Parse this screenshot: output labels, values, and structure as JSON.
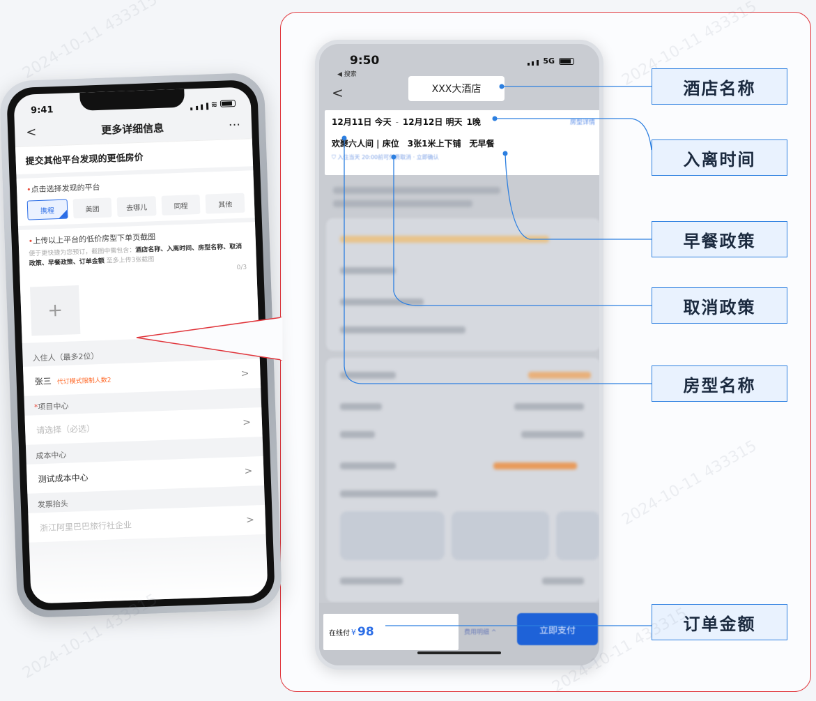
{
  "left_phone": {
    "status_time": "9:41",
    "nav_title": "更多详细信息",
    "nav_back": "<",
    "nav_more": "···",
    "section_title": "提交其他平台发现的更低房价",
    "platform_prompt": "点击选择发现的平台",
    "platforms": [
      "携程",
      "美团",
      "去哪儿",
      "同程",
      "其他"
    ],
    "upload_prompt": "上传以上平台的低价房型下单页截图",
    "upload_hint_prefix": "便于更快捷为您预订，截图中需包含：",
    "upload_hint_required": "酒店名称、入离时间、房型名称、取消政策、早餐政策、订单金额",
    "upload_hint_suffix": "至多上传3张截图",
    "upload_count": "0/3",
    "upload_plus": "+",
    "guest_label": "入住人（最多2位）",
    "guest_name": "张三",
    "guest_note": "代订模式限制人数2",
    "project_label": "项目中心",
    "project_placeholder": "请选择（必选）",
    "cost_label": "成本中心",
    "cost_value": "测试成本中心",
    "invoice_label": "发票抬头",
    "invoice_value": "浙江阿里巴巴旅行社企业",
    "arrow": ">"
  },
  "right_phone": {
    "status_time": "9:50",
    "status_sub": "◀ 搜索",
    "status_net": "5G",
    "back": "<",
    "hotel_name": "XXX大酒店",
    "check_in": "12月11日 今天",
    "dash": "-",
    "check_out": "12月12日 明天",
    "nights": "1晚",
    "room_detail_link": "房型详情",
    "room_name": "欢聚六人间 | 床位",
    "bed_type": "3张1米上下铺",
    "breakfast": "无早餐",
    "cancel_policy": "入住当天 20:00前可免费取消 · 立即确认",
    "price_prefix": "在线付",
    "price_currency": "¥",
    "price_amount": "98",
    "fee_detail": "费用明细 ^",
    "pay_button": "立即支付"
  },
  "annotations": [
    {
      "label": "酒店名称"
    },
    {
      "label": "入离时间"
    },
    {
      "label": "早餐政策"
    },
    {
      "label": "取消政策"
    },
    {
      "label": "房型名称"
    },
    {
      "label": "订单金额"
    }
  ],
  "colors": {
    "callout_border": "#e0353b",
    "annotation_line": "#2c7fe0",
    "annotation_bg": "#e9f2fe",
    "accent_blue": "#2b6de6",
    "pay_button": "#1e62d8"
  },
  "watermark_text": "2024-10-11 433315"
}
